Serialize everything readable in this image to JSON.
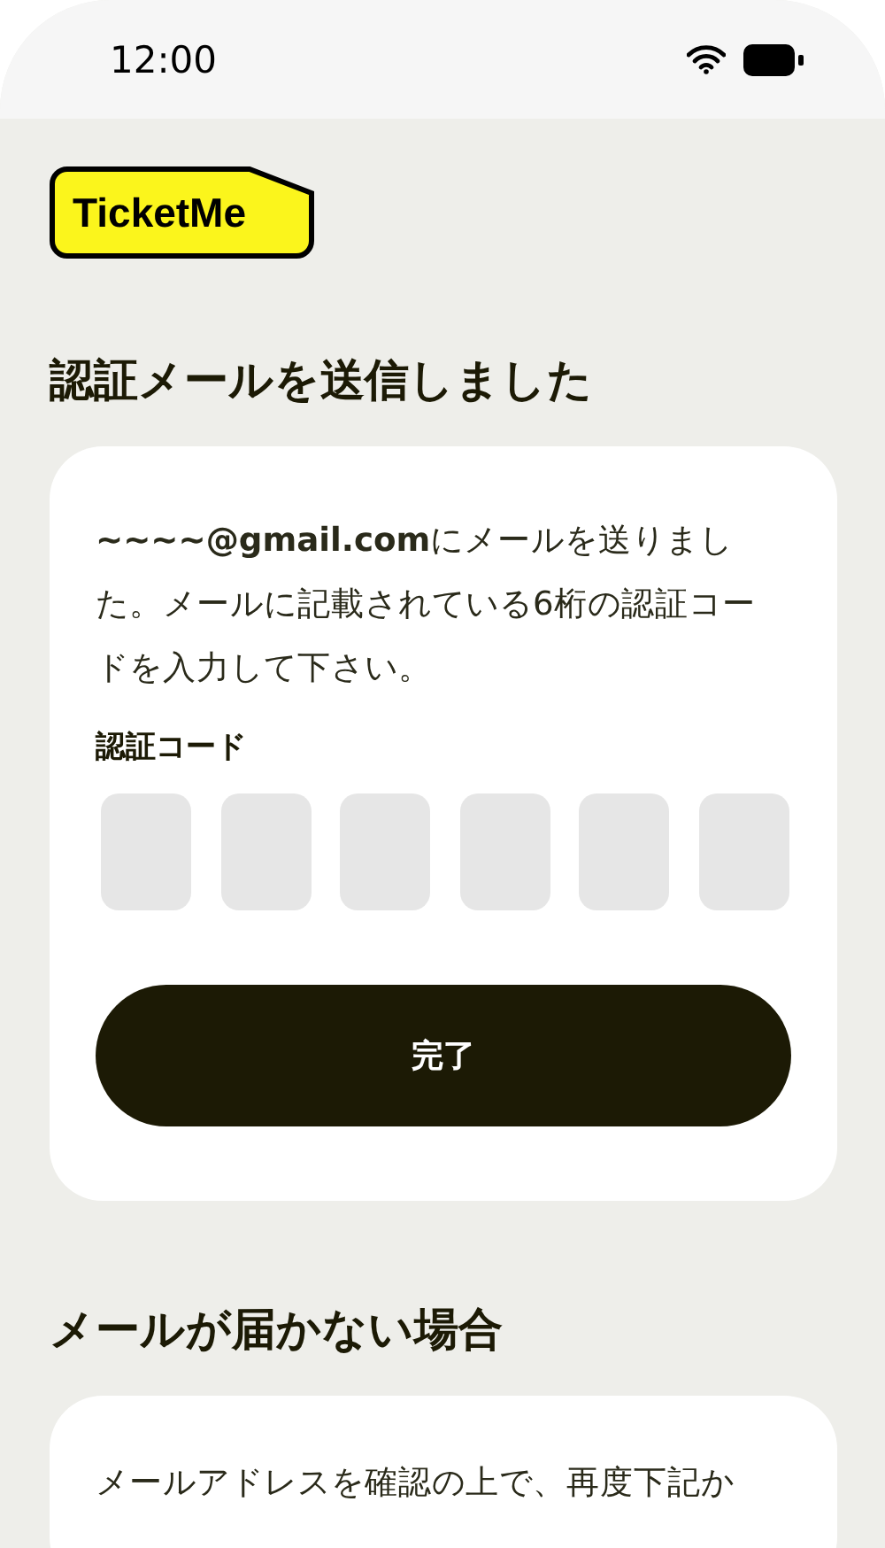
{
  "status_bar": {
    "time": "12:00"
  },
  "logo": {
    "text": "TicketMe"
  },
  "sections": [
    {
      "heading": "認証メールを送信しました",
      "kind": "verify",
      "message": "**~~~~@gmail.com**にメールを送りました。メールに記載されている6桁の認証コードを入力して下さい。",
      "code_label": "認証コード",
      "code_boxes": [
        {
          "kind": "digit"
        },
        {
          "kind": "digit"
        },
        {
          "kind": "digit"
        },
        {
          "kind": "digit"
        },
        {
          "kind": "digit"
        },
        {
          "kind": "digit"
        }
      ],
      "button": "完了"
    },
    {
      "heading": "メールが届かない場合",
      "kind": "info",
      "message": "メールアドレスを確認の上で、再度下記か"
    }
  ]
}
